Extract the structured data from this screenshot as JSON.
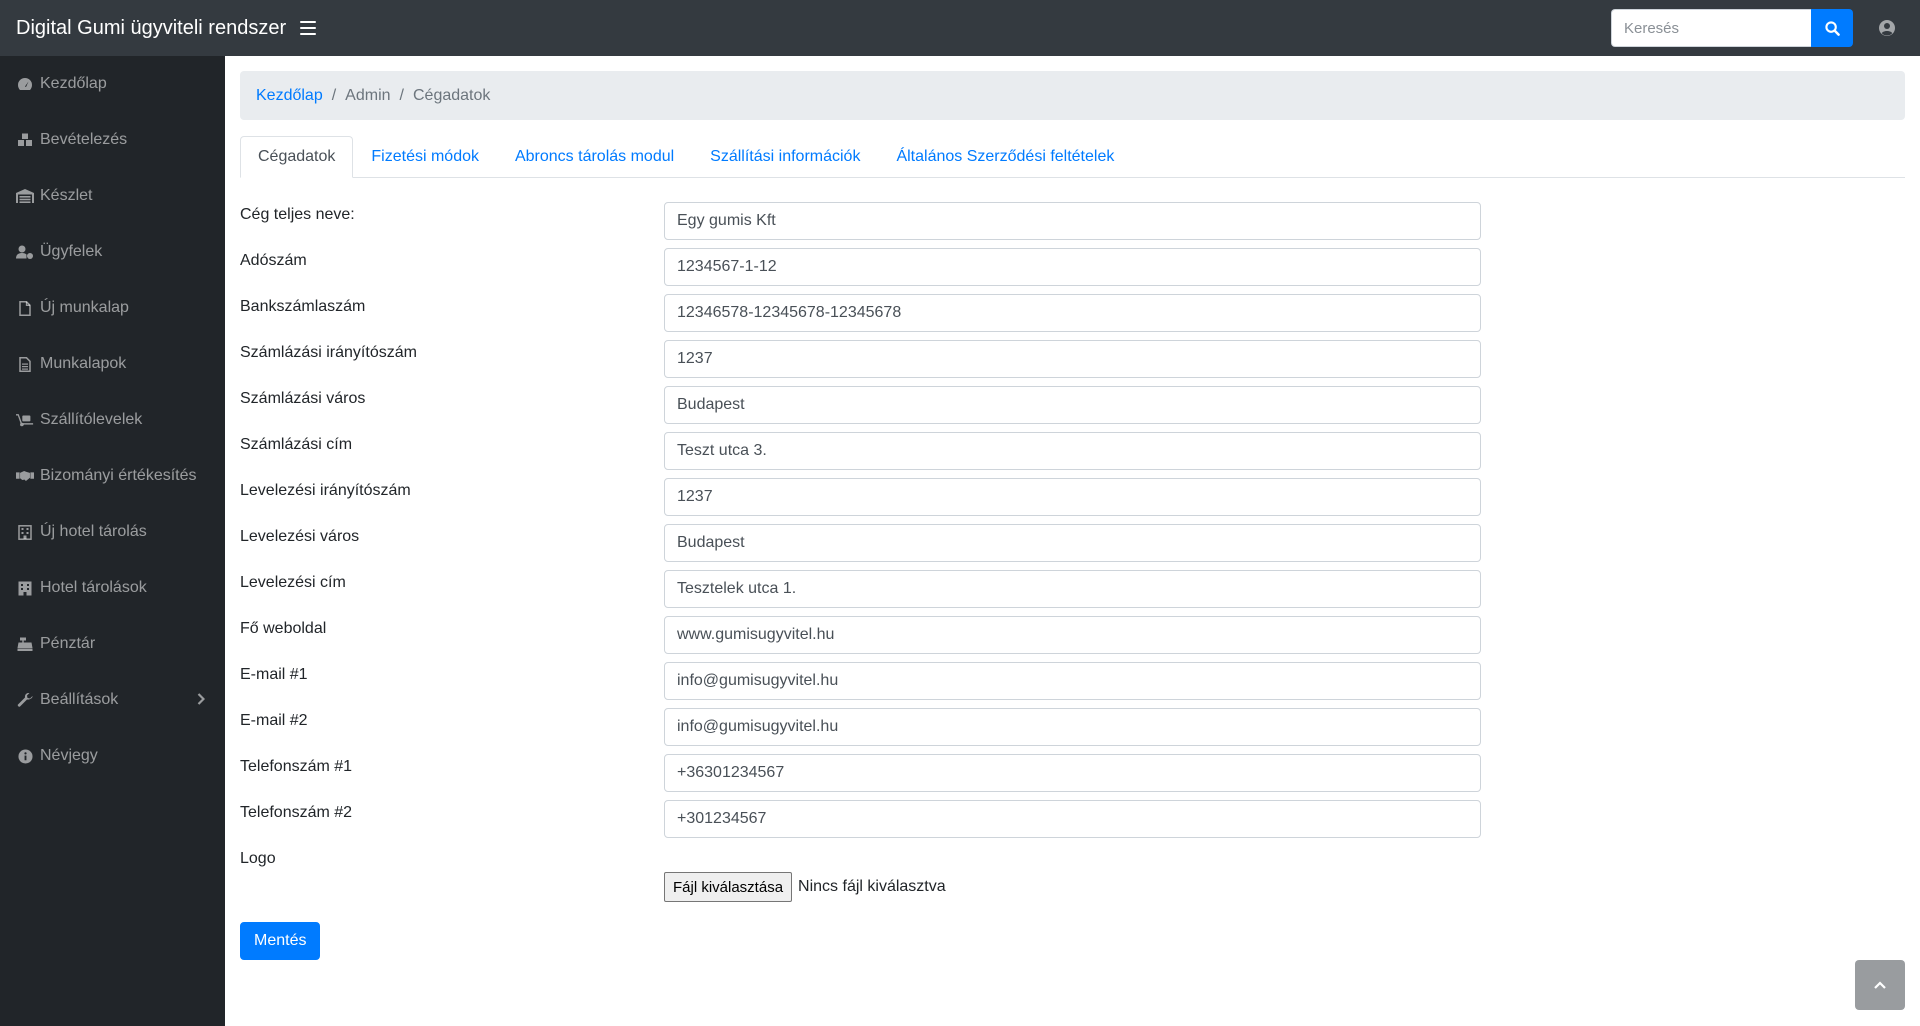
{
  "app": {
    "title": "Digital Gumi ügyviteli rendszer"
  },
  "search": {
    "placeholder": "Keresés"
  },
  "sidebar": {
    "items": [
      {
        "label": "Kezdőlap"
      },
      {
        "label": "Bevételezés"
      },
      {
        "label": "Készlet"
      },
      {
        "label": "Ügyfelek"
      },
      {
        "label": "Új munkalap"
      },
      {
        "label": "Munkalapok"
      },
      {
        "label": "Szállítólevelek"
      },
      {
        "label": "Bizományi értékesítés"
      },
      {
        "label": "Új hotel tárolás"
      },
      {
        "label": "Hotel tárolások"
      },
      {
        "label": "Pénztár"
      },
      {
        "label": "Beállítások"
      },
      {
        "label": "Névjegy"
      }
    ]
  },
  "breadcrumb": {
    "home": "Kezdőlap",
    "admin": "Admin",
    "current": "Cégadatok"
  },
  "tabs": [
    {
      "label": "Cégadatok"
    },
    {
      "label": "Fizetési módok"
    },
    {
      "label": "Abroncs tárolás modul"
    },
    {
      "label": "Szállítási információk"
    },
    {
      "label": "Általános Szerződési feltételek"
    }
  ],
  "form": {
    "fields": [
      {
        "label": "Cég teljes neve:",
        "value": "Egy gumis Kft"
      },
      {
        "label": "Adószám",
        "value": "1234567-1-12"
      },
      {
        "label": "Bankszámlaszám",
        "value": "12346578-12345678-12345678"
      },
      {
        "label": "Számlázási irányítószám",
        "value": "1237"
      },
      {
        "label": "Számlázási város",
        "value": "Budapest"
      },
      {
        "label": "Számlázási cím",
        "value": "Teszt utca 3."
      },
      {
        "label": "Levelezési irányítószám",
        "value": "1237"
      },
      {
        "label": "Levelezési város",
        "value": "Budapest"
      },
      {
        "label": "Levelezési cím",
        "value": "Tesztelek utca 1."
      },
      {
        "label": "Fő weboldal",
        "value": "www.gumisugyvitel.hu"
      },
      {
        "label": "E-mail #1",
        "value": "info@gumisugyvitel.hu"
      },
      {
        "label": "E-mail #2",
        "value": "info@gumisugyvitel.hu"
      },
      {
        "label": "Telefonszám #1",
        "value": "+36301234567"
      },
      {
        "label": "Telefonszám #2",
        "value": "+301234567"
      }
    ],
    "logo_label": "Logo",
    "file_button": "Fájl kiválasztása",
    "file_status": "Nincs fájl kiválasztva",
    "save_label": "Mentés"
  },
  "colors": {
    "navbar": "#343a40",
    "sidebar": "#212529",
    "accent": "#007bff",
    "breadcrumb_bg": "#e9ecef"
  }
}
